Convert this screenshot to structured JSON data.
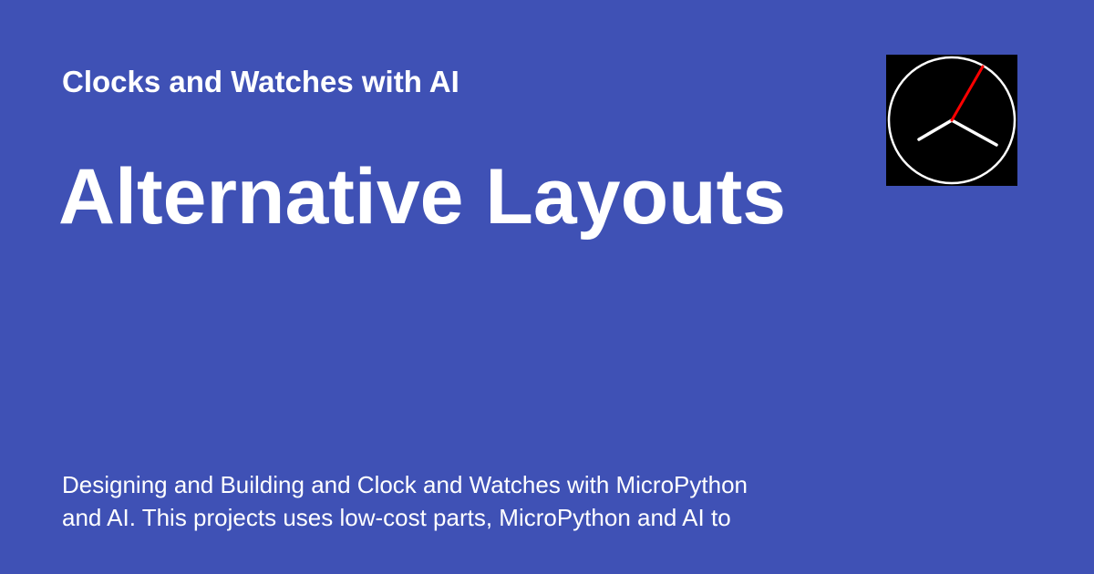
{
  "card": {
    "site_name": "Clocks and Watches with AI",
    "page_title": "Alternative Layouts",
    "description_line1": "Designing and Building and Clock and Watches with MicroPython",
    "description_line2": "and AI.  This projects uses low-cost parts, MicroPython and AI to"
  },
  "logo": {
    "icon": "analog-clock-icon",
    "face_color": "#000000",
    "rim_color": "#ffffff",
    "hand_color": "#ffffff",
    "second_hand_color": "#ff0000"
  },
  "colors": {
    "background": "#3f51b5",
    "text": "#ffffff"
  }
}
